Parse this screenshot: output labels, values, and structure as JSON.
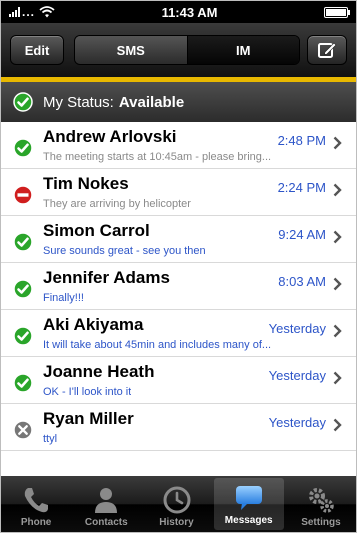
{
  "status_bar": {
    "carrier_dots": "...",
    "time": "11:43 AM"
  },
  "toolbar": {
    "edit_label": "Edit",
    "segments": [
      "SMS",
      "IM"
    ],
    "selected_segment": "SMS"
  },
  "my_status": {
    "label": "My Status:",
    "value": "Available"
  },
  "conversations": [
    {
      "name": "Andrew Arlovski",
      "preview": "The meeting starts at 10:45am - please bring...",
      "time": "2:48 PM",
      "status": "available",
      "preview_style": "grey"
    },
    {
      "name": "Tim Nokes",
      "preview": "They are arriving by helicopter",
      "time": "2:24 PM",
      "status": "busy",
      "preview_style": "grey"
    },
    {
      "name": "Simon Carrol",
      "preview": "Sure sounds great - see you then",
      "time": "9:24 AM",
      "status": "available",
      "preview_style": "blue"
    },
    {
      "name": "Jennifer Adams",
      "preview": "Finally!!!",
      "time": "8:03 AM",
      "status": "available",
      "preview_style": "blue"
    },
    {
      "name": "Aki Akiyama",
      "preview": "It will take about 45min and includes many of...",
      "time": "Yesterday",
      "status": "available",
      "preview_style": "blue"
    },
    {
      "name": "Joanne Heath",
      "preview": "OK - I'll look into it",
      "time": "Yesterday",
      "status": "available",
      "preview_style": "blue"
    },
    {
      "name": "Ryan Miller",
      "preview": "ttyl",
      "time": "Yesterday",
      "status": "offline",
      "preview_style": "blue"
    }
  ],
  "tabs": [
    {
      "label": "Phone",
      "icon": "phone-icon"
    },
    {
      "label": "Contacts",
      "icon": "contacts-icon"
    },
    {
      "label": "History",
      "icon": "clock-icon"
    },
    {
      "label": "Messages",
      "icon": "speech-bubble-icon"
    },
    {
      "label": "Settings",
      "icon": "gears-icon"
    }
  ],
  "active_tab": "Messages",
  "colors": {
    "accent_gold": "#e8b800",
    "time_blue": "#2d55c8",
    "available_green": "#2aa52a",
    "busy_red": "#d01e1e",
    "offline_grey": "#777777"
  }
}
